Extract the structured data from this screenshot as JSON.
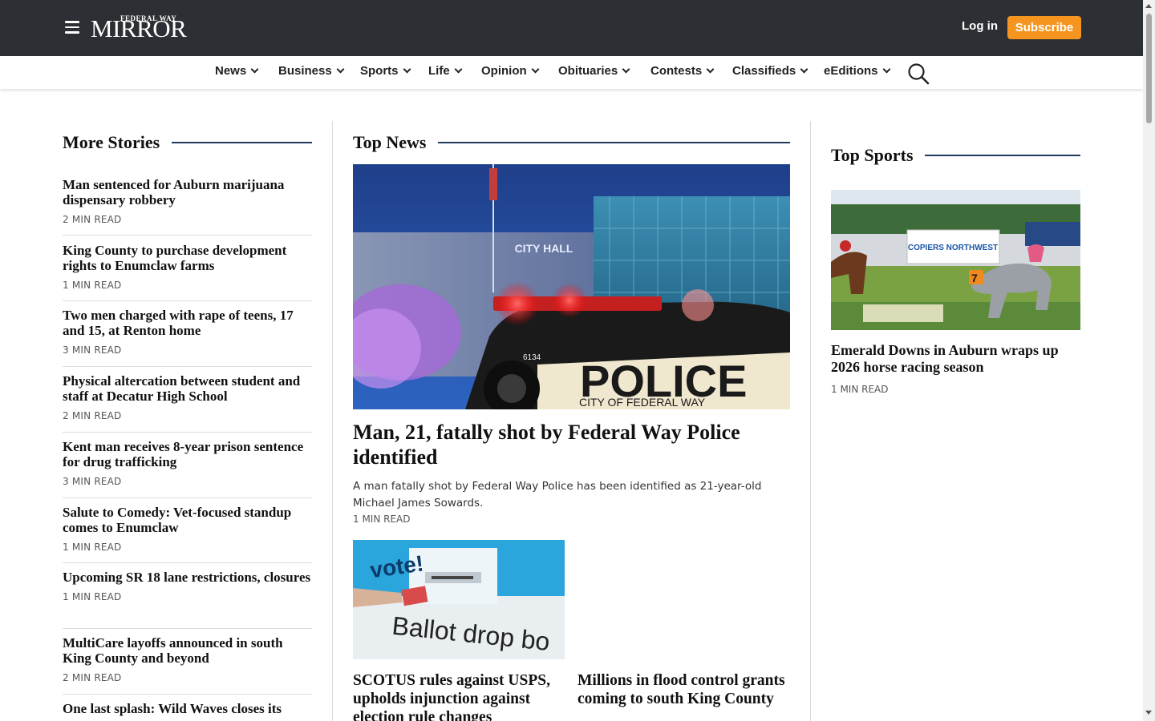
{
  "header": {
    "logo_small": "FEDERAL WAY",
    "logo_big": "MIRROR",
    "login_label": "Log in",
    "subscribe_label": "Subscribe",
    "subscribe_color": "#f5951f",
    "bar_color": "#2c2f33"
  },
  "nav": {
    "items": [
      {
        "label": "News"
      },
      {
        "label": "Business"
      },
      {
        "label": "Sports"
      },
      {
        "label": "Life"
      },
      {
        "label": "Opinion"
      },
      {
        "label": "Obituaries"
      },
      {
        "label": "Contests"
      },
      {
        "label": "Classifieds"
      },
      {
        "label": "eEditions"
      }
    ],
    "search_icon": "search-icon"
  },
  "more_stories": {
    "title": "More Stories",
    "items": [
      {
        "title": "Man sentenced for Auburn marijuana dispensary robbery",
        "read": "2 MIN READ"
      },
      {
        "title": "King County to purchase development rights to Enumclaw farms",
        "read": "1 MIN READ"
      },
      {
        "title": "Two men charged with rape of teens, 17 and 15, at Renton home",
        "read": "3 MIN READ"
      },
      {
        "title": "Physical altercation between student and staff at Decatur High School",
        "read": "2 MIN READ"
      },
      {
        "title": "Kent man receives 8-year prison sentence for drug trafficking",
        "read": "3 MIN READ"
      },
      {
        "title": "Salute to Comedy: Vet-focused standup comes to Enumclaw",
        "read": "1 MIN READ"
      },
      {
        "title": "Upcoming SR 18 lane restrictions, closures",
        "read": "1 MIN READ"
      },
      {
        "title": "MultiCare layoffs announced in south King County and beyond",
        "read": "2 MIN READ"
      },
      {
        "title": "One last splash: Wild Waves closes its",
        "read": ""
      }
    ]
  },
  "top_news": {
    "title": "Top News",
    "hero": {
      "image_text_hall": "CITY HALL",
      "image_text_police": "POLICE",
      "image_text_city": "CITY OF FEDERAL WAY",
      "image_text_unit": "6134",
      "title": "Man, 21, fatally shot by Federal Way Police identified",
      "dek": "A man fatally shot by Federal Way Police has been identified as 21-year-old Michael James Sowards.",
      "read": "1 MIN READ"
    },
    "sub_left": {
      "image_text_vote": "vote!",
      "image_text_ballot": "Ballot drop bo",
      "title": "SCOTUS rules against USPS, upholds injunction against election rule changes"
    },
    "sub_right": {
      "title": "Millions in flood control grants coming to south King County"
    }
  },
  "top_sports": {
    "title": "Top Sports",
    "image_text_sign": "COPIERS NORTHWEST",
    "image_text_number": "7",
    "title_story": "Emerald Downs in Auburn wraps up 2026 horse racing season",
    "read": "1 MIN READ"
  }
}
